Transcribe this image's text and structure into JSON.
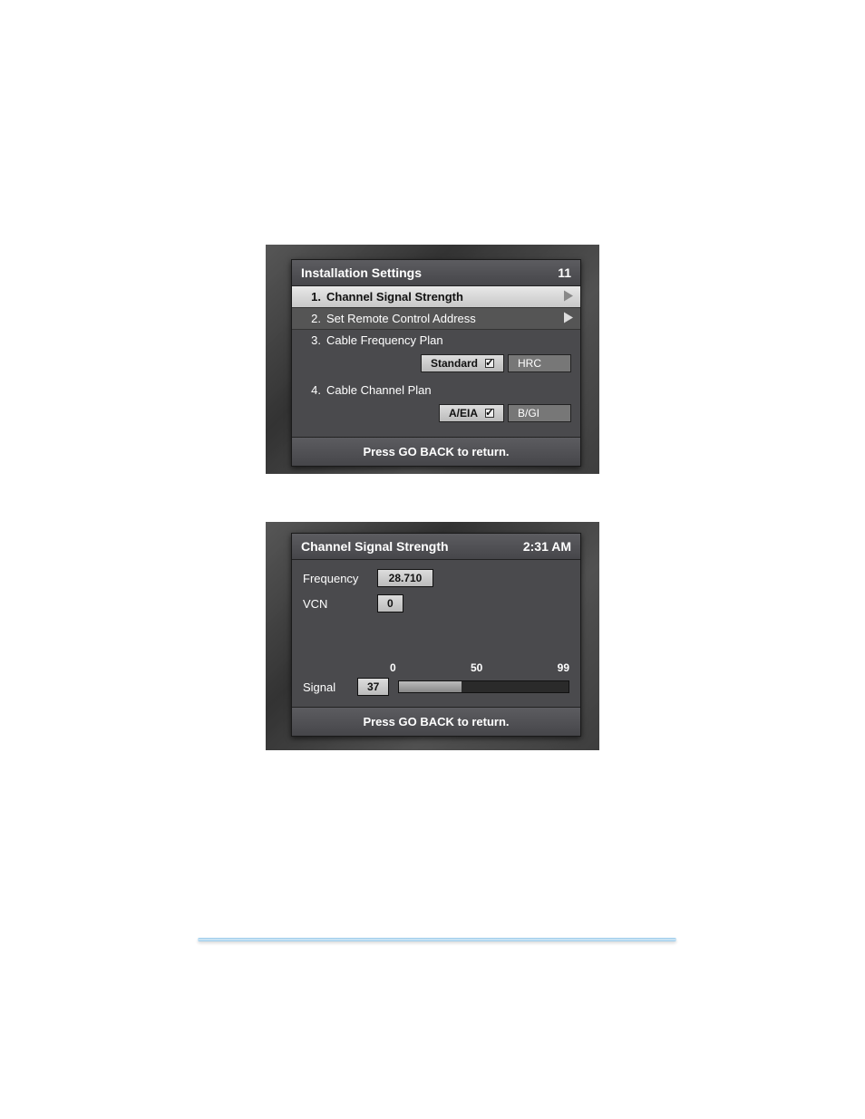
{
  "panel1": {
    "title": "Installation Settings",
    "chapter": "11",
    "items": [
      {
        "num": "1.",
        "label": "Channel Signal Strength"
      },
      {
        "num": "2.",
        "label": "Set Remote Control Address"
      },
      {
        "num": "3.",
        "label": "Cable Frequency Plan"
      },
      {
        "num": "4.",
        "label": "Cable Channel Plan"
      }
    ],
    "freq_options": {
      "a": "Standard",
      "b": "HRC"
    },
    "chan_options": {
      "a": "A/EIA",
      "b": "B/GI"
    },
    "footer": "Press GO BACK to return."
  },
  "panel2": {
    "title": "Channel Signal Strength",
    "time": "2:31 AM",
    "frequency_label": "Frequency",
    "frequency_value": "28.710",
    "vcn_label": "VCN",
    "vcn_value": "0",
    "scale": {
      "min": "0",
      "mid": "50",
      "max": "99"
    },
    "signal_label": "Signal",
    "signal_value": "37",
    "signal_fill_pct": "37%",
    "footer": "Press GO BACK to return."
  }
}
